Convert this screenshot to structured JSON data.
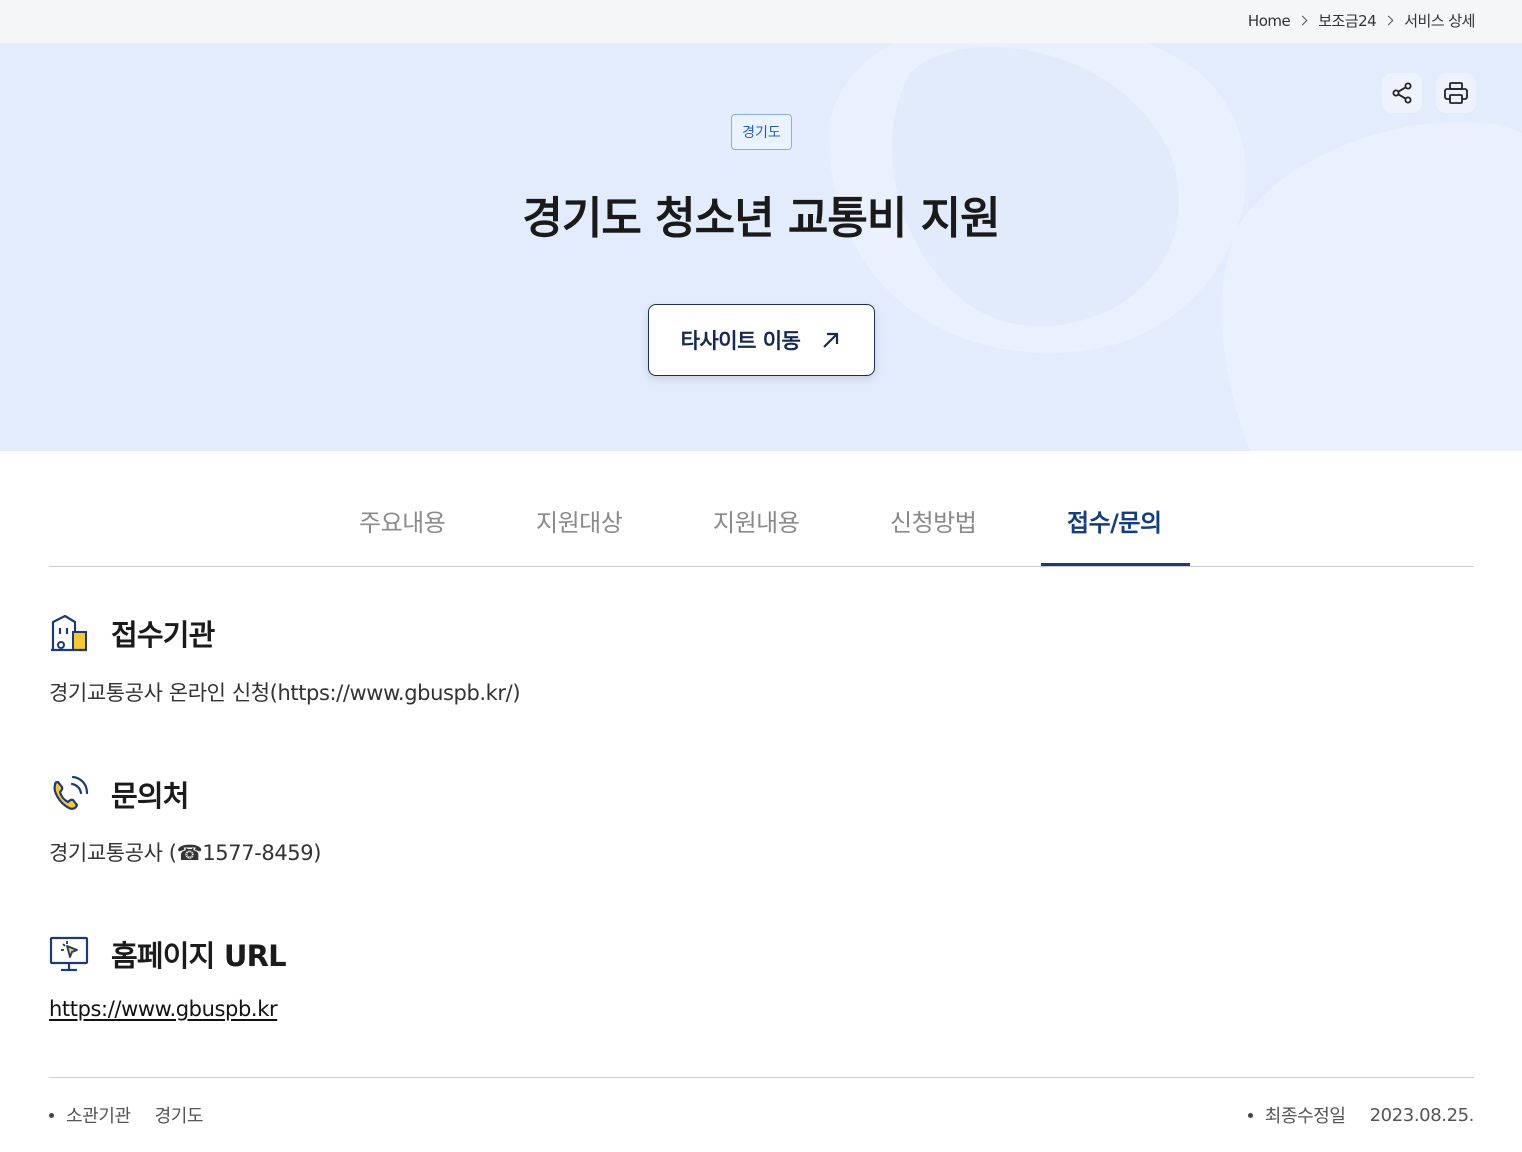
{
  "breadcrumb": {
    "home": "Home",
    "level1": "보조금24",
    "level2": "서비스 상세"
  },
  "hero": {
    "region_badge": "경기도",
    "title": "경기도 청소년 교통비 지원",
    "external_button": "타사이트 이동",
    "background_color": "#e3ecfc"
  },
  "tabs": [
    {
      "label": "주요내용",
      "active": false
    },
    {
      "label": "지원대상",
      "active": false
    },
    {
      "label": "지원내용",
      "active": false
    },
    {
      "label": "신청방법",
      "active": false
    },
    {
      "label": "접수/문의",
      "active": true
    }
  ],
  "sections": {
    "reception": {
      "icon": "building-icon",
      "title": "접수기관",
      "body": "경기교통공사 온라인 신청(https://www.gbuspb.kr/)"
    },
    "contact": {
      "icon": "phone-icon",
      "title": "문의처",
      "body": "경기교통공사 (☎1577-8459)"
    },
    "homepage": {
      "icon": "monitor-cursor-icon",
      "title": "홈페이지 URL",
      "link": "https://www.gbuspb.kr"
    }
  },
  "footer": {
    "agency_label": "소관기관",
    "agency_value": "경기도",
    "modified_label": "최종수정일",
    "modified_value": "2023.08.25."
  },
  "colors": {
    "accent": "#163d7d",
    "icon_yellow": "#f5c83a",
    "icon_navy": "#1d3a73"
  }
}
